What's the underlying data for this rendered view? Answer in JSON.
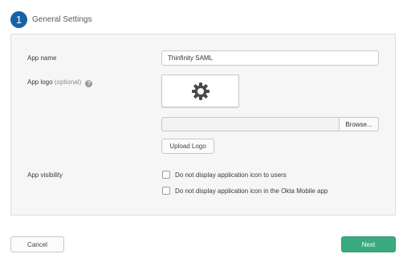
{
  "step": {
    "number": "1",
    "title": "General Settings",
    "accent": "#1662a8"
  },
  "form": {
    "app_name": {
      "label": "App name",
      "value": "Thinfinity SAML"
    },
    "app_logo": {
      "label": "App logo",
      "optional": "(optional)",
      "help_icon": "question-icon",
      "logo_icon": "gear-icon",
      "browse_label": "Browse...",
      "upload_label": "Upload Logo",
      "file_value": ""
    },
    "app_visibility": {
      "label": "App visibility",
      "options": [
        {
          "label": "Do not display application icon to users",
          "checked": false
        },
        {
          "label": "Do not display application icon in the Okta Mobile app",
          "checked": false
        }
      ]
    }
  },
  "footer": {
    "cancel_label": "Cancel",
    "next_label": "Next",
    "next_color": "#3aab80"
  }
}
